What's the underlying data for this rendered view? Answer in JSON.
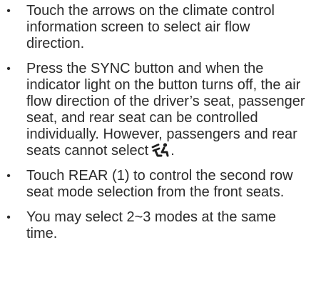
{
  "bullet_symbol": "•",
  "items": [
    {
      "text": "Touch the arrows on the climate control information screen to select air flow direction."
    },
    {
      "text": "Press the SYNC button and when the indicator light on the button turns off, the air flow direction of the driver’s seat, passenger seat, and rear seat can be controlled individually. However, passengers and rear seats cannot select",
      "text_after_icon": ".",
      "icon": "seat-airflow-icon"
    },
    {
      "text": "Touch REAR (1) to control the second row seat mode selection from the front seats."
    },
    {
      "text": "You may select 2~3 modes at the same time."
    }
  ]
}
